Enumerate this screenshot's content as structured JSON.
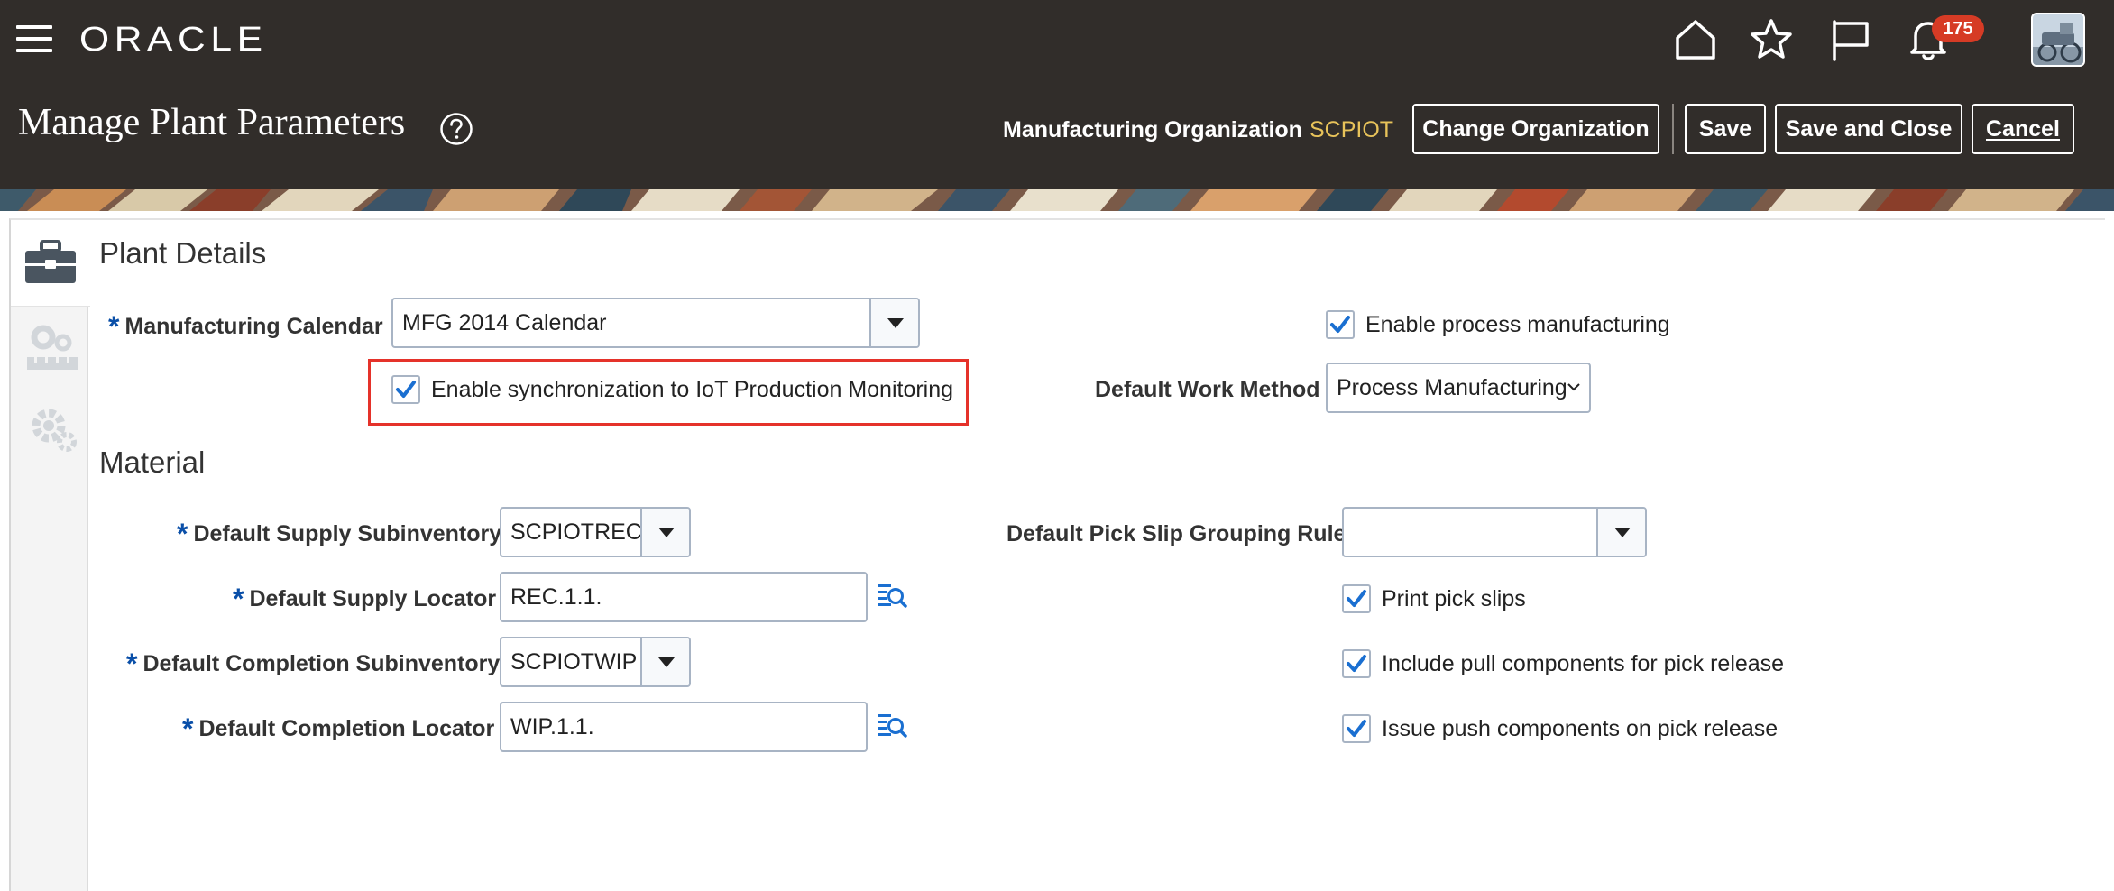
{
  "topbar": {
    "brand": "ORACLE",
    "notification_count": "175",
    "icons": [
      "menu-icon",
      "home-icon",
      "favorites-star-icon",
      "flag-icon",
      "bell-icon",
      "user-avatar"
    ]
  },
  "header": {
    "title": "Manage Plant Parameters",
    "org_label": "Manufacturing Organization",
    "org_value": "SCPIOT",
    "buttons": {
      "change_org": "Change Organization",
      "save": "Save",
      "save_close": "Save and Close",
      "cancel": "Cancel"
    }
  },
  "plant_details": {
    "title": "Plant Details",
    "calendar_label": "Manufacturing Calendar",
    "calendar_value": "MFG 2014 Calendar",
    "iot_sync_label": "Enable synchronization to IoT Production Monitoring",
    "iot_sync_checked": true,
    "process_mfg_label": "Enable process manufacturing",
    "process_mfg_checked": true,
    "work_method_label": "Default Work Method",
    "work_method_value": "Process Manufacturing"
  },
  "material": {
    "title": "Material",
    "supply_subinv_label": "Default Supply Subinventory",
    "supply_subinv_value": "SCPIOTREC",
    "supply_locator_label": "Default Supply Locator",
    "supply_locator_value": "REC.1.1.",
    "completion_subinv_label": "Default Completion Subinventory",
    "completion_subinv_value": "SCPIOTWIP",
    "completion_locator_label": "Default Completion Locator",
    "completion_locator_value": "WIP.1.1.",
    "pick_slip_rule_label": "Default Pick Slip Grouping Rule",
    "pick_slip_rule_value": "",
    "print_pick_slips_label": "Print pick slips",
    "include_pull_label": "Include pull components for pick release",
    "issue_push_label": "Issue push components on pick release"
  },
  "required_marker": "*",
  "colors": {
    "header_bg": "#312d2a",
    "org_value": "#e8c35a",
    "required": "#0a4fa8",
    "check": "#1a6fd1",
    "highlight": "#e5322a",
    "badge": "#d63b25"
  }
}
